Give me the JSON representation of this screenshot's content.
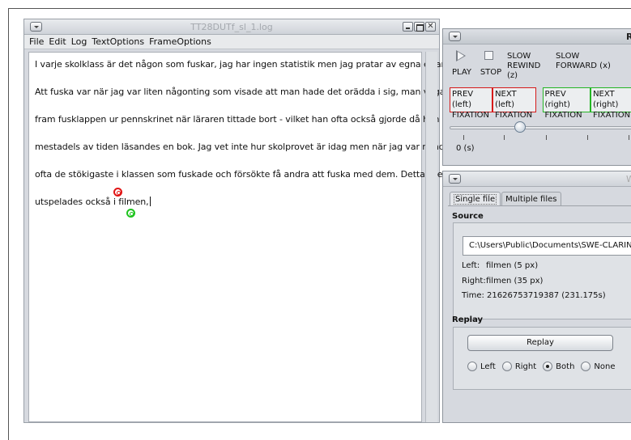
{
  "left_window": {
    "title": "TT28DUTf_sl_1.log",
    "menu": [
      "File",
      "Edit",
      "Log",
      "TextOptions",
      "FrameOptions"
    ],
    "text_lines": [
      "I varje skolklass är det någon som fuskar, jag har ingen statistik men jag pratar av egna erfarenheter.",
      "Att fuska var när jag var liten någonting som visade att man hade det orädda i sig, man vågade att ta",
      "fram fusklappen ur pennskrinet när läraren tittade bort - vilket han ofta också gjorde då han satt",
      "mestadels av tiden läsandes en bok. Jag vet inte hur skolprovet är idag men när jag var mindre var det",
      "ofta de stökigaste i klassen som fuskade och försökte få andra att fuska med dem. Detta scenario",
      "utspelades också i filmen,"
    ]
  },
  "replay_window": {
    "title": "R",
    "play_label": "PLAY",
    "stop_label": "STOP",
    "slow_rewind": [
      "SLOW",
      "REWIND (z)"
    ],
    "slow_forward": [
      "SLOW",
      "FORWARD (x)"
    ],
    "prev_left": [
      "PREV (left)",
      "FIXATION"
    ],
    "next_left": [
      "NEXT (left)",
      "FIXATION"
    ],
    "prev_right": [
      "PREV (right)",
      "FIXATION"
    ],
    "next_right": [
      "NEXT (right)",
      "FIXATION"
    ],
    "slider_label": "0 (s)"
  },
  "bottom_window": {
    "title": "W",
    "tabs": [
      "Single file",
      "Multiple files"
    ],
    "source_title": "Source",
    "path": "C:\\Users\\Public\\Documents\\SWE-CLARIN\\",
    "left_label": "Left:",
    "left_value": "filmen (5 px)",
    "right_label": "Right:",
    "right_value": "filmen (35 px)",
    "time_line": "Time: 21626753719387 (231.175s)",
    "replay_title": "Replay",
    "replay_button": "Replay",
    "radio_options": [
      "Left",
      "Right",
      "Both",
      "None"
    ],
    "radio_selected": "Both"
  }
}
